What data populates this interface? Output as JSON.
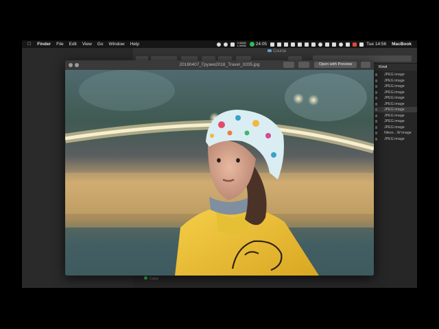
{
  "menubar": {
    "apple": "",
    "app_name": "Finder",
    "menus": [
      "File",
      "Edit",
      "View",
      "Go",
      "Window",
      "Help"
    ],
    "net_up": "0.08KB",
    "net_down": "1.59KB",
    "timer": "24:05",
    "clock": "Tue 14:56",
    "device": "MacBook"
  },
  "finder": {
    "title": "Course",
    "kind_header": "Kind",
    "kinds": [
      "JPEG image",
      "JPEG image",
      "JPEG image",
      "JPEG image",
      "JPEG image",
      "JPEG image",
      "JPEG image",
      "JPEG image",
      "JPEG image",
      "JPEG image",
      "Nikon…W image",
      "JPEG image"
    ],
    "selected_index": 6,
    "tag_label": "Color"
  },
  "quicklook": {
    "filename": "20180407_Грузия2018_Travel_0205.jpg",
    "open_with": "Open with Preview"
  },
  "colors": {
    "menubar_bg": "#161616",
    "accent_green": "#2fbf53",
    "jacket_yellow": "#f0c233"
  }
}
